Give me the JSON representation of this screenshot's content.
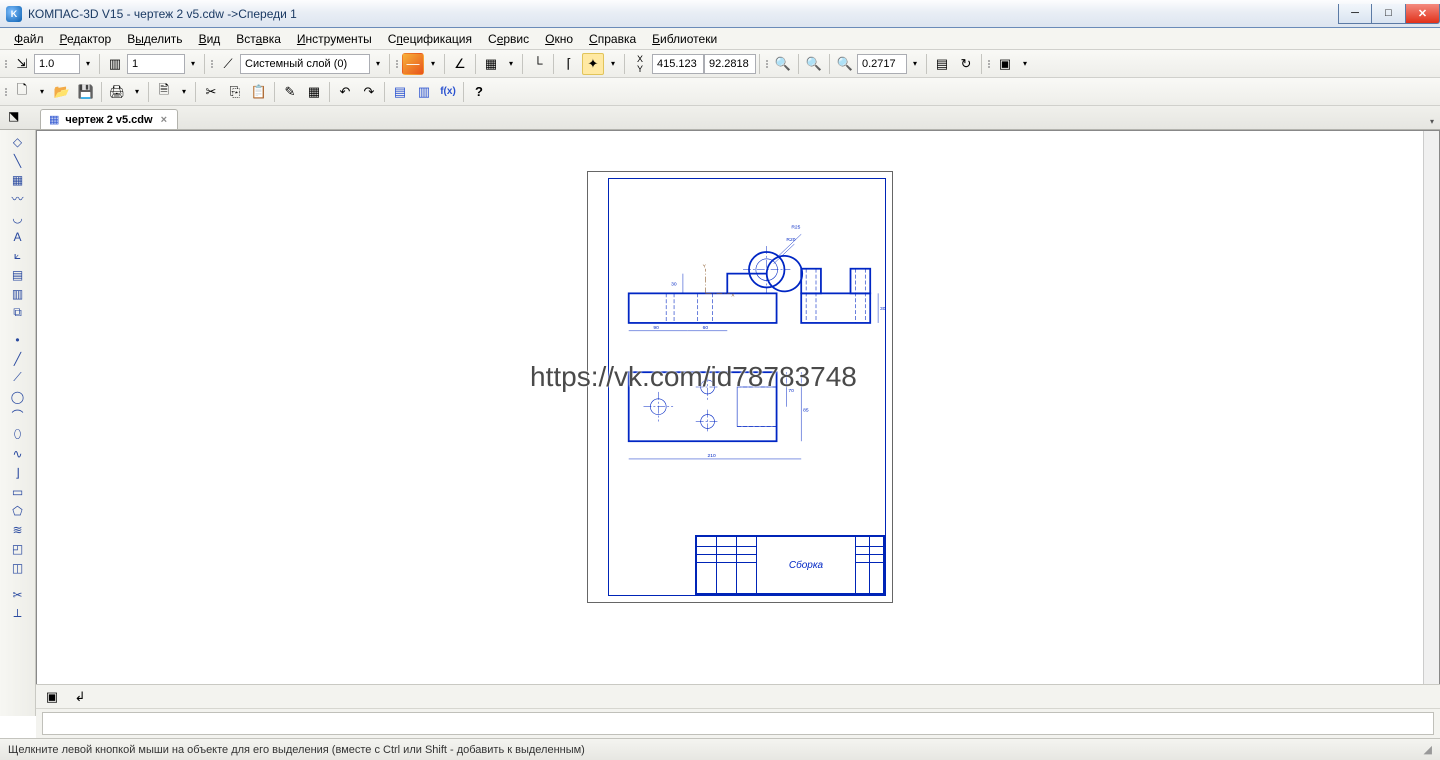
{
  "title": "КОМПАС-3D V15 - чертеж 2 v5.cdw ->Спереди 1",
  "menu": [
    "Файл",
    "Редактор",
    "Выделить",
    "Вид",
    "Вставка",
    "Инструменты",
    "Спецификация",
    "Сервис",
    "Окно",
    "Справка",
    "Библиотеки"
  ],
  "top1": {
    "scale": "1.0",
    "page": "1",
    "layer": "Системный слой (0)",
    "x_lbl": "X",
    "y_lbl": "Y",
    "x": "415.123",
    "y": "92.2818",
    "zoom": "0.2717"
  },
  "tab": {
    "name": "чертеж 2 v5.cdw"
  },
  "drawing": {
    "title_block_name": "Сборка",
    "dim_r25": "R25",
    "dim_r20": "R20",
    "dim_90": "90",
    "dim_60": "60",
    "dim_30_a": "30",
    "dim_30_b": "30",
    "dim_70": "70",
    "dim_85": "85",
    "dim_210": "210",
    "lblX": "X",
    "lblY": "Y"
  },
  "watermark": "https://vk.com/id78783748",
  "status": "Щелкните левой кнопкой мыши на объекте для его выделения (вместе с Ctrl или Shift - добавить к выделенным)"
}
